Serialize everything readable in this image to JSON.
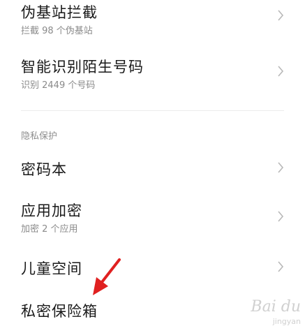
{
  "settings": {
    "items": [
      {
        "title": "伪基站拦截",
        "subtitle": "拦截 98 个伪基站"
      },
      {
        "title": "智能识别陌生号码",
        "subtitle": "识别 2449 个号码"
      },
      {
        "title": "密码本"
      },
      {
        "title": "应用加密",
        "subtitle": "加密 2 个应用"
      },
      {
        "title": "儿童空间"
      },
      {
        "title": "私密保险箱"
      }
    ],
    "section_privacy": "隐私保护"
  },
  "overlay": {
    "arrow_color": "#e02020",
    "watermark_text": "Bai du",
    "watermark_sub": "jingyan"
  },
  "icons": {
    "chevron": "chevron-right-icon",
    "arrow": "red-arrow-annotation"
  }
}
